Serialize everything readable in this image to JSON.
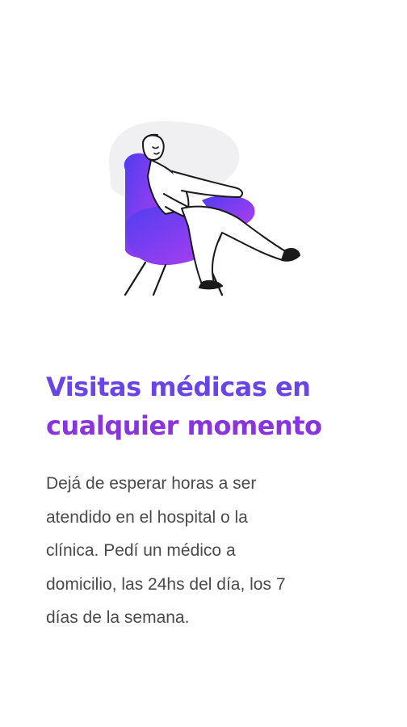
{
  "illustration": {
    "icon": "person-relaxing-in-armchair-icon",
    "gradient_start": "#4f3df0",
    "gradient_end": "#b13ff0",
    "backdrop": "#f0f0f3"
  },
  "onboarding": {
    "title_lines": [
      "Visitas médicas en",
      "cualquier momento"
    ],
    "description_lines": [
      "Dejá de esperar horas a ser",
      "atendido en el hospital o la",
      "clínica. Pedí un médico a",
      "domicilio, las 24hs del día, los 7",
      "días de la semana."
    ]
  }
}
